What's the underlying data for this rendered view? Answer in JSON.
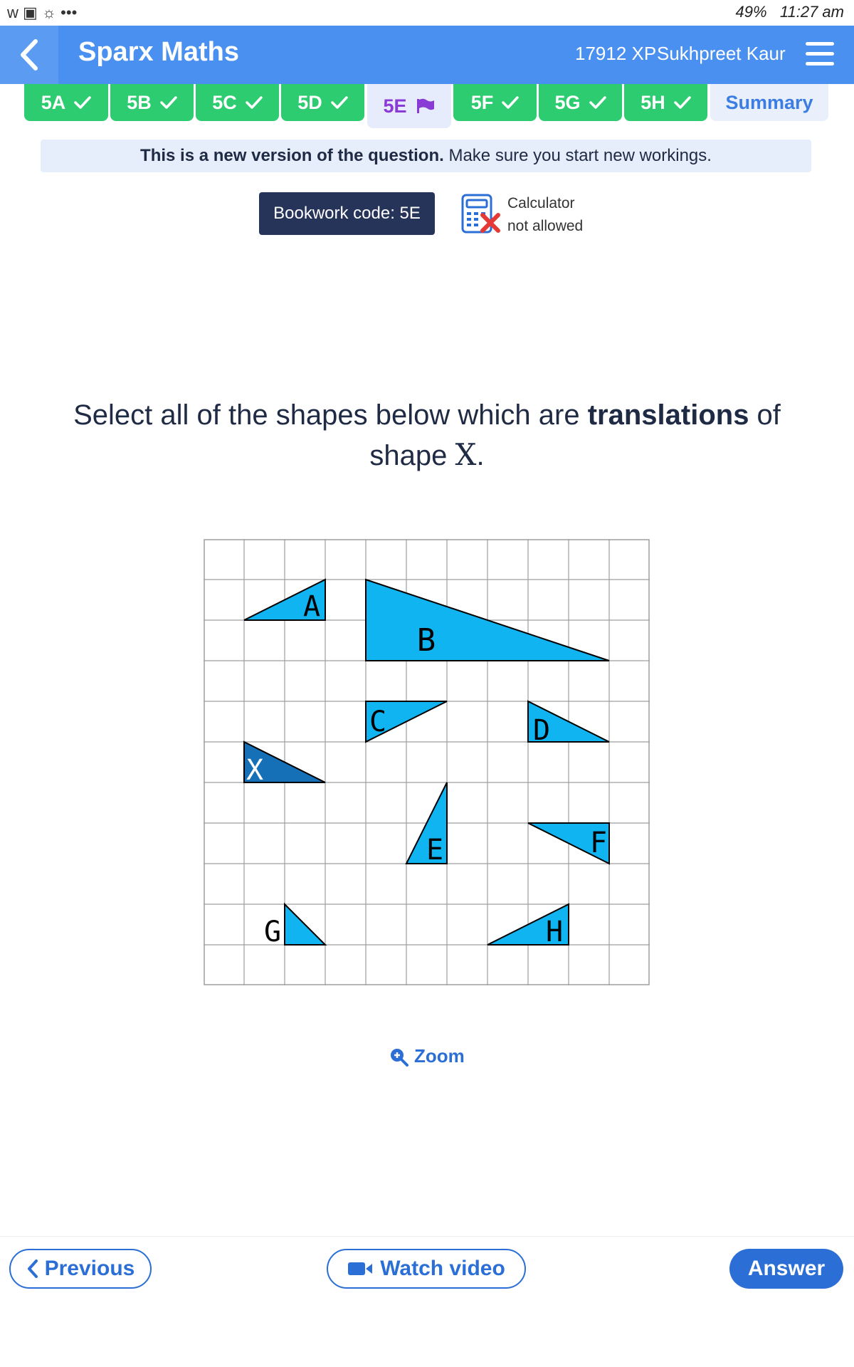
{
  "status_bar": {
    "left_icons": "w ▣ ☼ •••",
    "battery": "49%",
    "time": "11:27 am"
  },
  "header": {
    "brand": "Sparx Maths",
    "xp": "17912 XP",
    "user": "Sukhpreet Kaur"
  },
  "tabs": [
    {
      "label": "5A",
      "state": "done"
    },
    {
      "label": "5B",
      "state": "done"
    },
    {
      "label": "5C",
      "state": "done"
    },
    {
      "label": "5D",
      "state": "done"
    },
    {
      "label": "5E",
      "state": "current"
    },
    {
      "label": "5F",
      "state": "done"
    },
    {
      "label": "5G",
      "state": "done"
    },
    {
      "label": "5H",
      "state": "done"
    },
    {
      "label": "Summary",
      "state": "summary"
    }
  ],
  "notice": {
    "bold": "This is a new version of the question.",
    "rest": " Make sure you start new workings."
  },
  "bookwork": {
    "label": "Bookwork code: 5E"
  },
  "calculator": {
    "line1": "Calculator",
    "line2": "not allowed"
  },
  "question": {
    "part1": "Select all of the shapes below which are ",
    "bold": "translations",
    "part2": " of",
    "part3": "shape ",
    "shape": "X",
    "end": "."
  },
  "shapes": {
    "A": "A",
    "B": "B",
    "C": "C",
    "D": "D",
    "E": "E",
    "F": "F",
    "G": "G",
    "H": "H",
    "X": "X"
  },
  "zoom": {
    "label": "Zoom"
  },
  "footer": {
    "previous": "Previous",
    "watch_video": "Watch video",
    "answer": "Answer"
  },
  "colors": {
    "appbar": "#4a90f0",
    "tab_done": "#2ecc71",
    "shape_fill": "#10b4f0",
    "shape_x_fill": "#1670b8",
    "accent": "#2b6fd6"
  }
}
